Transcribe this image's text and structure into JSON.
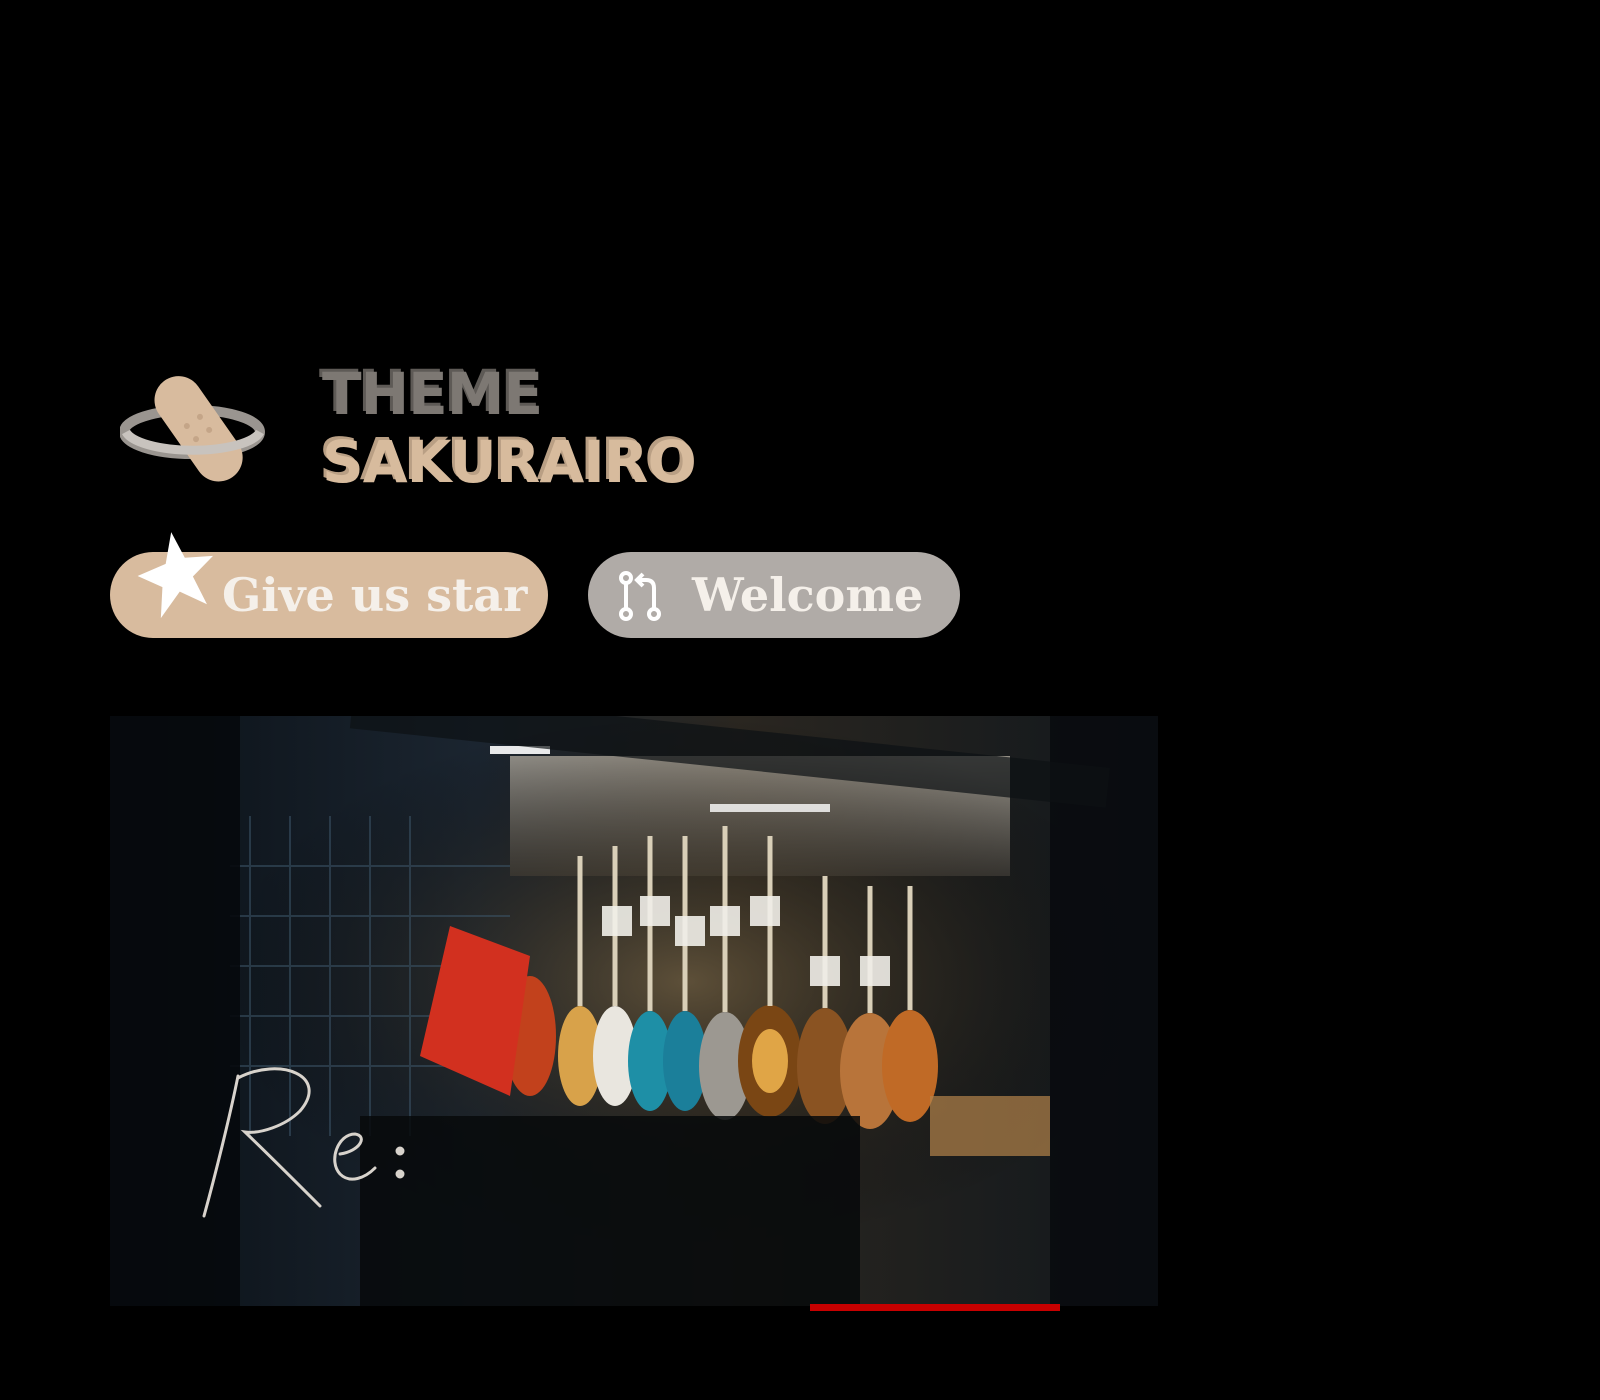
{
  "brand": {
    "line1": "THEME",
    "line2": "SAKURAIRO",
    "logo_icon": "bandage-halo-icon",
    "colors": {
      "line1": "#7d7873",
      "line2": "#d7bb9d"
    }
  },
  "buttons": {
    "star": {
      "label": "Give us star",
      "icon": "star-icon",
      "color": "#d8bb9e"
    },
    "welcome": {
      "label": "Welcome",
      "icon": "pull-request-icon",
      "color": "#b0aba7"
    }
  },
  "banner": {
    "handwriting": "Re:",
    "subject": "guitar-shop-photo",
    "accent": "#c70000"
  }
}
